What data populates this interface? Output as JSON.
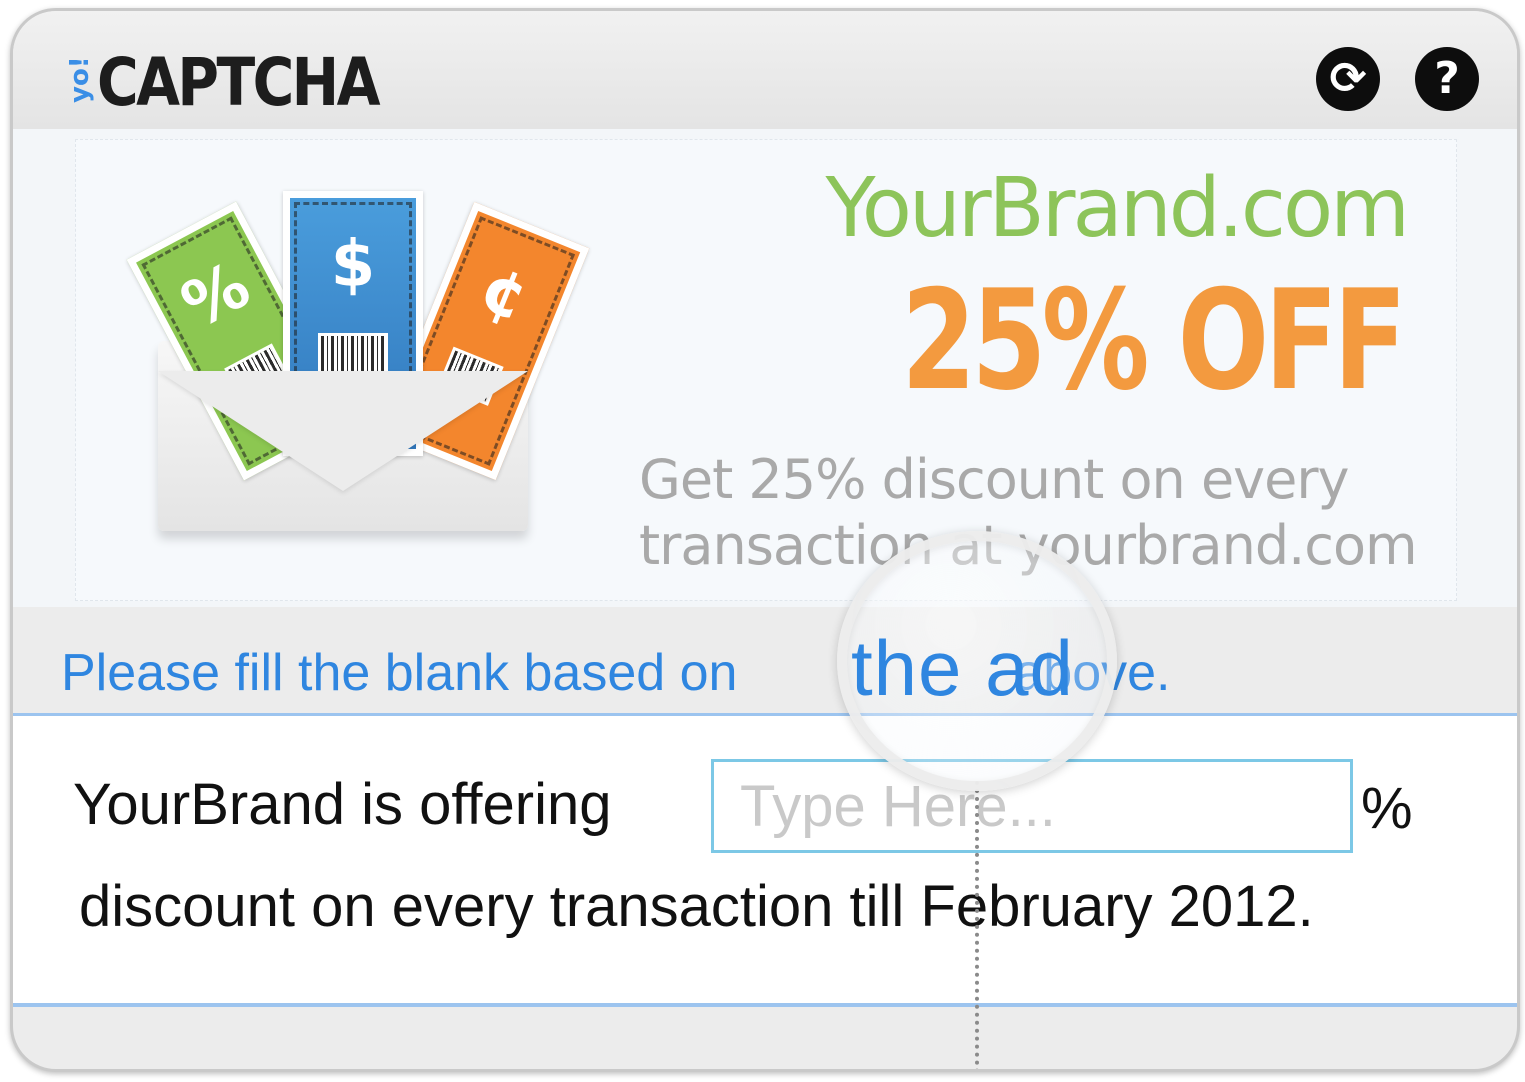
{
  "header": {
    "logo_prefix": "yo!",
    "logo_main": "CAPTCHA",
    "refresh_icon": "refresh-icon",
    "help_icon": "help-icon",
    "refresh_glyph": "⟳",
    "help_glyph": "?"
  },
  "ad": {
    "brand": "YourBrand.com",
    "headline": "25% OFF",
    "body": "Get 25%  discount  on  every transaction at yourbrand.com",
    "coupon_symbols": [
      "%",
      "$",
      "¢"
    ],
    "colors": {
      "brand_green": "#8dc45a",
      "headline_orange": "#f39a3f",
      "coupon_green": "#8cc751",
      "coupon_blue": "#3f8fd2",
      "coupon_orange": "#f3862d"
    }
  },
  "challenge": {
    "instruction_before": "Please fill the blank based on",
    "instruction_highlight": "the ad",
    "instruction_after": "above.",
    "question_part1": "YourBrand is offering",
    "answer_placeholder": "Type Here...",
    "answer_value": "",
    "question_unit": "%",
    "question_part2": "discount on every transaction till February 2012.",
    "accent_color": "#2f86e0"
  }
}
